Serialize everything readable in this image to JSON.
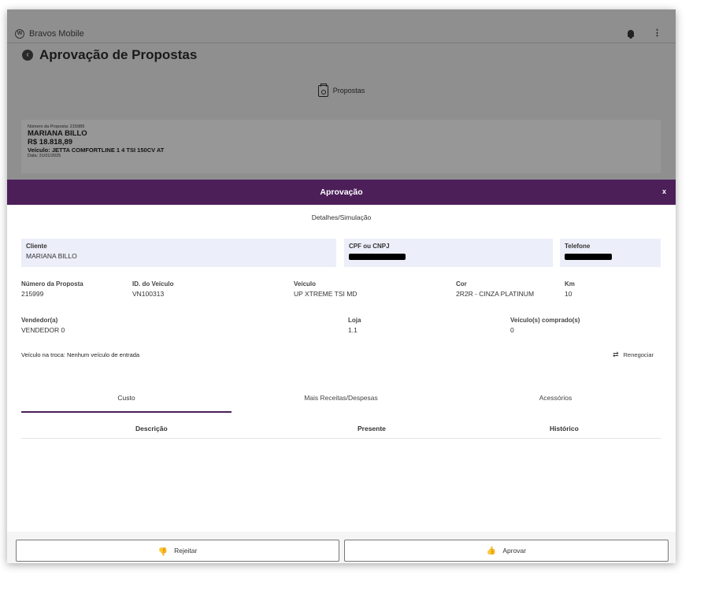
{
  "app": {
    "name": "Bravos Mobile",
    "logo_icon": "vw-logo-icon",
    "notification_icon": "bell-icon",
    "menu_icon": "kebab-menu-icon"
  },
  "page": {
    "title": "Aprovação de Propostas",
    "back_icon": "back-arrow-icon"
  },
  "propostas": {
    "header": "Propostas",
    "icon": "clipboard-search-icon",
    "card": {
      "numero": "Número da Proposta: 215989",
      "cliente": "MARIANA BILLO",
      "valor": "R$ 18.818,89",
      "veiculo": "Veículo: JETTA COMFORTLINE 1 4 TSI 150CV AT",
      "data": "Data: 31/01/2025"
    }
  },
  "modal": {
    "title": "Aprovação",
    "close": "x",
    "subtitle": "Detalhes/Simulação",
    "fields": {
      "cliente_label": "Cliente",
      "cliente_value": "MARIANA BILLO",
      "cpf_label": "CPF ou CNPJ",
      "telefone_label": "Telefone"
    },
    "details": {
      "numero_label": "Número da Proposta",
      "numero_value": "215999",
      "id_veiculo_label": "ID. do Veículo",
      "id_veiculo_value": "VN100313",
      "veiculo_label": "Veículo",
      "veiculo_value": "UP XTREME TSI MD",
      "cor_label": "Cor",
      "cor_value": "2R2R - CINZA PLATINUM",
      "km_label": "Km",
      "km_value": "10",
      "vendedor_label": "Vendedor(a)",
      "vendedor_value": "VENDEDOR 0",
      "loja_label": "Loja",
      "loja_value": "1.1",
      "comprados_label": "Veículo(s) comprado(s)",
      "comprados_value": "0"
    },
    "trade_in": "Veículo na troca: Nenhum veículo de entrada",
    "renegociar": "Renegociar",
    "tabs": [
      "Custo",
      "Mais Receitas/Despesas",
      "Acessórios"
    ],
    "active_tab": "Custo",
    "table_headers": [
      "Descrição",
      "Presente",
      "Histórico"
    ],
    "buttons": {
      "reject": "Rejeitar",
      "approve": "Aprovar"
    }
  },
  "colors": {
    "accent": "#4c1f59",
    "field_bg": "#eceef9"
  }
}
